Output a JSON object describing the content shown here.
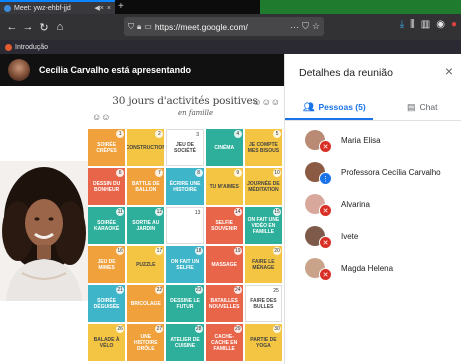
{
  "browser": {
    "tab_title": "Meet: ywz-ehbf-jjd",
    "tab_close": "×",
    "tab_speaker": "◀×",
    "new_tab": "+",
    "url": "https://meet.google.com/",
    "url_more": "···",
    "bookmark": "Introdução"
  },
  "meeting": {
    "presenter_text": "Cecília Carvalho está apresentando"
  },
  "document": {
    "title": "30 jours d'activités positives",
    "subtitle": "en famille",
    "cells": [
      {
        "n": "1",
        "t": "Soirée crêpes",
        "c": "#f0a13b"
      },
      {
        "n": "2",
        "t": "Construction",
        "c": "#f4c542"
      },
      {
        "n": "3",
        "t": "Jeu de société",
        "c": "#ffffff"
      },
      {
        "n": "4",
        "t": "Cinéma",
        "c": "#2eaf9b"
      },
      {
        "n": "5",
        "t": "Je compte mes bisous",
        "c": "#f4c542"
      },
      {
        "n": "6",
        "t": "Dessin du bonheur",
        "c": "#e9654a"
      },
      {
        "n": "7",
        "t": "Battle de ballon",
        "c": "#f0a13b"
      },
      {
        "n": "8",
        "t": "Écrire une histoire",
        "c": "#3fb5c9"
      },
      {
        "n": "9",
        "t": "Tu m'aimes",
        "c": "#f4c542"
      },
      {
        "n": "10",
        "t": "Journée de méditation",
        "c": "#f4c542"
      },
      {
        "n": "11",
        "t": "Soirée karaoké",
        "c": "#2eaf9b"
      },
      {
        "n": "12",
        "t": "Sortie au jardin",
        "c": "#2eaf9b"
      },
      {
        "n": "13",
        "t": "",
        "c": "#ffffff"
      },
      {
        "n": "14",
        "t": "Selfie souvenir",
        "c": "#e9654a"
      },
      {
        "n": "15",
        "t": "On fait une vidéo en famille",
        "c": "#2eaf9b"
      },
      {
        "n": "16",
        "t": "Jeu de mimes",
        "c": "#f0a13b"
      },
      {
        "n": "17",
        "t": "Puzzle",
        "c": "#f4c542"
      },
      {
        "n": "18",
        "t": "On fait un selfie",
        "c": "#3fb5c9"
      },
      {
        "n": "19",
        "t": "Massage",
        "c": "#e9654a"
      },
      {
        "n": "20",
        "t": "Faire le ménage",
        "c": "#f4c542"
      },
      {
        "n": "21",
        "t": "Soirée déguisée",
        "c": "#3fb5c9"
      },
      {
        "n": "22",
        "t": "Bricolage",
        "c": "#f0a13b"
      },
      {
        "n": "23",
        "t": "Dessine le futur",
        "c": "#2eaf9b"
      },
      {
        "n": "24",
        "t": "Batailles nouvelles",
        "c": "#e9654a"
      },
      {
        "n": "25",
        "t": "Faire des bulles",
        "c": "#ffffff"
      },
      {
        "n": "26",
        "t": "Balade à vélo",
        "c": "#f4c542"
      },
      {
        "n": "27",
        "t": "Une histoire drôle",
        "c": "#f0a13b"
      },
      {
        "n": "28",
        "t": "Atelier de cuisine",
        "c": "#2eaf9b"
      },
      {
        "n": "29",
        "t": "Cache-cache en famille",
        "c": "#e9654a"
      },
      {
        "n": "30",
        "t": "Partie de yoga",
        "c": "#f4c542"
      }
    ]
  },
  "panel": {
    "title": "Detalhes da reunião",
    "close": "×",
    "tab_people": "Pessoas (5)",
    "tab_chat": "Chat",
    "participants": [
      {
        "name": "Maria Elisa",
        "muted": true,
        "avatar": "#b98a74"
      },
      {
        "name": "Professora Cecília Carvalho",
        "muted": false,
        "avatar": "#8a5a43"
      },
      {
        "name": "Alvarina",
        "muted": true,
        "avatar": "#d9a89c"
      },
      {
        "name": "Ivete",
        "muted": true,
        "avatar": "#7d5a4a"
      },
      {
        "name": "Magda Helena",
        "muted": true,
        "avatar": "#c9a48a"
      }
    ]
  }
}
